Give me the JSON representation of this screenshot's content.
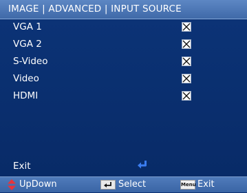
{
  "header": {
    "title": "IMAGE | ADVANCED | INPUT SOURCE"
  },
  "sources": [
    {
      "label": "VGA 1",
      "checked": true
    },
    {
      "label": "VGA 2",
      "checked": true
    },
    {
      "label": "S-Video",
      "checked": true
    },
    {
      "label": "Video",
      "checked": true
    },
    {
      "label": "HDMI",
      "checked": true
    }
  ],
  "exit": {
    "label": "Exit",
    "icon": "enter-arrow-icon"
  },
  "footer": {
    "updown_label": "UpDown",
    "select_label": "Select",
    "menu_key_label": "Menu",
    "exit_label": "Exit"
  },
  "colors": {
    "background": "#0a2f70",
    "title_bar": "#4a74b2",
    "enter_icon": "#3b7df0",
    "updown_icon": "#e8343a"
  }
}
